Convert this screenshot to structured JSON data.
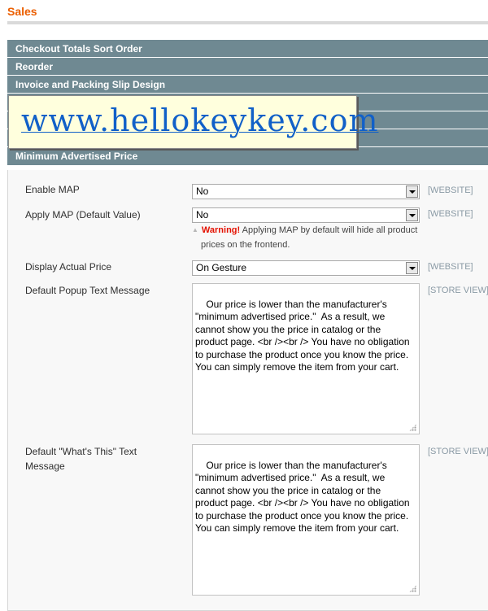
{
  "header": {
    "title": "Sales"
  },
  "sections": [
    {
      "label": "Checkout Totals Sort Order"
    },
    {
      "label": "Reorder"
    },
    {
      "label": "Invoice and Packing Slip Design"
    },
    {
      "label": ""
    },
    {
      "label": ""
    },
    {
      "label": ""
    },
    {
      "label": "Minimum Advertised Price"
    }
  ],
  "watermark": {
    "text": "www.hellokeykey.com"
  },
  "form": {
    "enable_map": {
      "label": "Enable MAP",
      "value": "No",
      "scope": "[WEBSITE]"
    },
    "apply_map": {
      "label": "Apply MAP (Default Value)",
      "value": "No",
      "scope": "[WEBSITE]",
      "note_warning": "Warning!",
      "note_line1": " Applying MAP by default will hide all product",
      "note_line2": "prices on the frontend."
    },
    "display_actual_price": {
      "label": "Display Actual Price",
      "value": "On Gesture",
      "scope": "[WEBSITE]"
    },
    "popup_text": {
      "label": "Default Popup Text Message",
      "value": "Our price is lower than the manufacturer's\n\"minimum advertised price.\"  As a result, we\ncannot show you the price in catalog or the\nproduct page. <br /><br /> You have no obligation\nto purchase the product once you know the price.\nYou can simply remove the item from your cart.",
      "scope": "[STORE VIEW]"
    },
    "whats_this_text": {
      "label": "Default \"What's This\" Text Message",
      "value": "Our price is lower than the manufacturer's\n\"minimum advertised price.\"  As a result, we\ncannot show you the price in catalog or the\nproduct page. <br /><br /> You have no obligation\nto purchase the product once you know the price.\nYou can simply remove the item from your cart.",
      "scope": "[STORE VIEW]"
    }
  }
}
